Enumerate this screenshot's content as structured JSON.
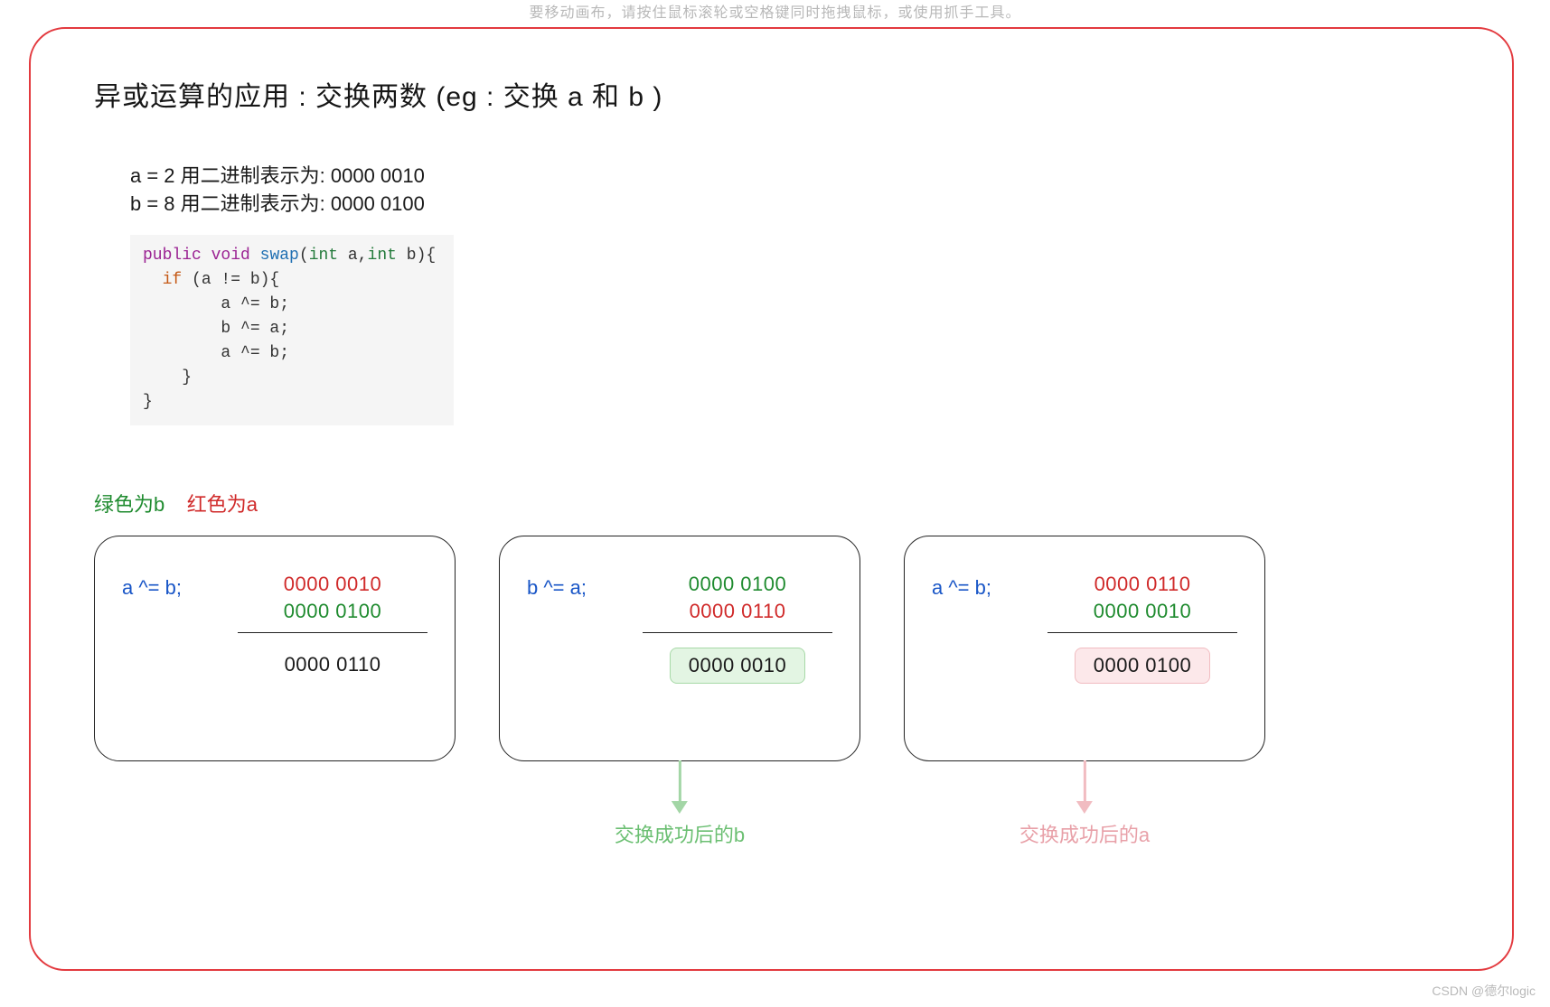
{
  "hint": "要移动画布，请按住鼠标滚轮或空格键同时拖拽鼠标，或使用抓手工具。",
  "title": "异或运算的应用 : 交换两数 (eg : 交换 a 和 b )",
  "intro": {
    "lineA": "a = 2  用二进制表示为: 0000 0010",
    "lineB": "b = 8  用二进制表示为: 0000 0100"
  },
  "code": {
    "kw_public": "public",
    "kw_void": "void",
    "fn": "swap",
    "type": "int",
    "paramA": "a",
    "paramB": "b",
    "kw_if": "if",
    "line3": "a ^= b;",
    "line4": "b ^= a;",
    "line5": "a ^= b;"
  },
  "legend": {
    "greenIs": "绿色为b",
    "redIs": "红色为a"
  },
  "cards": [
    {
      "op": "a ^= b;",
      "rows": [
        "0000 0010",
        "0000 0100"
      ],
      "rowClasses": [
        "red-txt",
        "green-txt"
      ],
      "result": "0000 0110",
      "resultClass": "result-plain",
      "arrow": null,
      "caption": null
    },
    {
      "op": "b ^= a;",
      "rows": [
        "0000 0100",
        "0000 0110"
      ],
      "rowClasses": [
        "green-txt",
        "red-txt"
      ],
      "result": "0000 0010",
      "resultClass": "result-green",
      "arrow": "green",
      "caption": "交换成功后的b"
    },
    {
      "op": "a ^= b;",
      "rows": [
        "0000 0110",
        "0000 0010"
      ],
      "rowClasses": [
        "red-txt",
        "green-txt"
      ],
      "result": "0000 0100",
      "resultClass": "result-pink",
      "arrow": "pink",
      "caption": "交换成功后的a"
    }
  ],
  "watermark": "CSDN @德尔logic"
}
